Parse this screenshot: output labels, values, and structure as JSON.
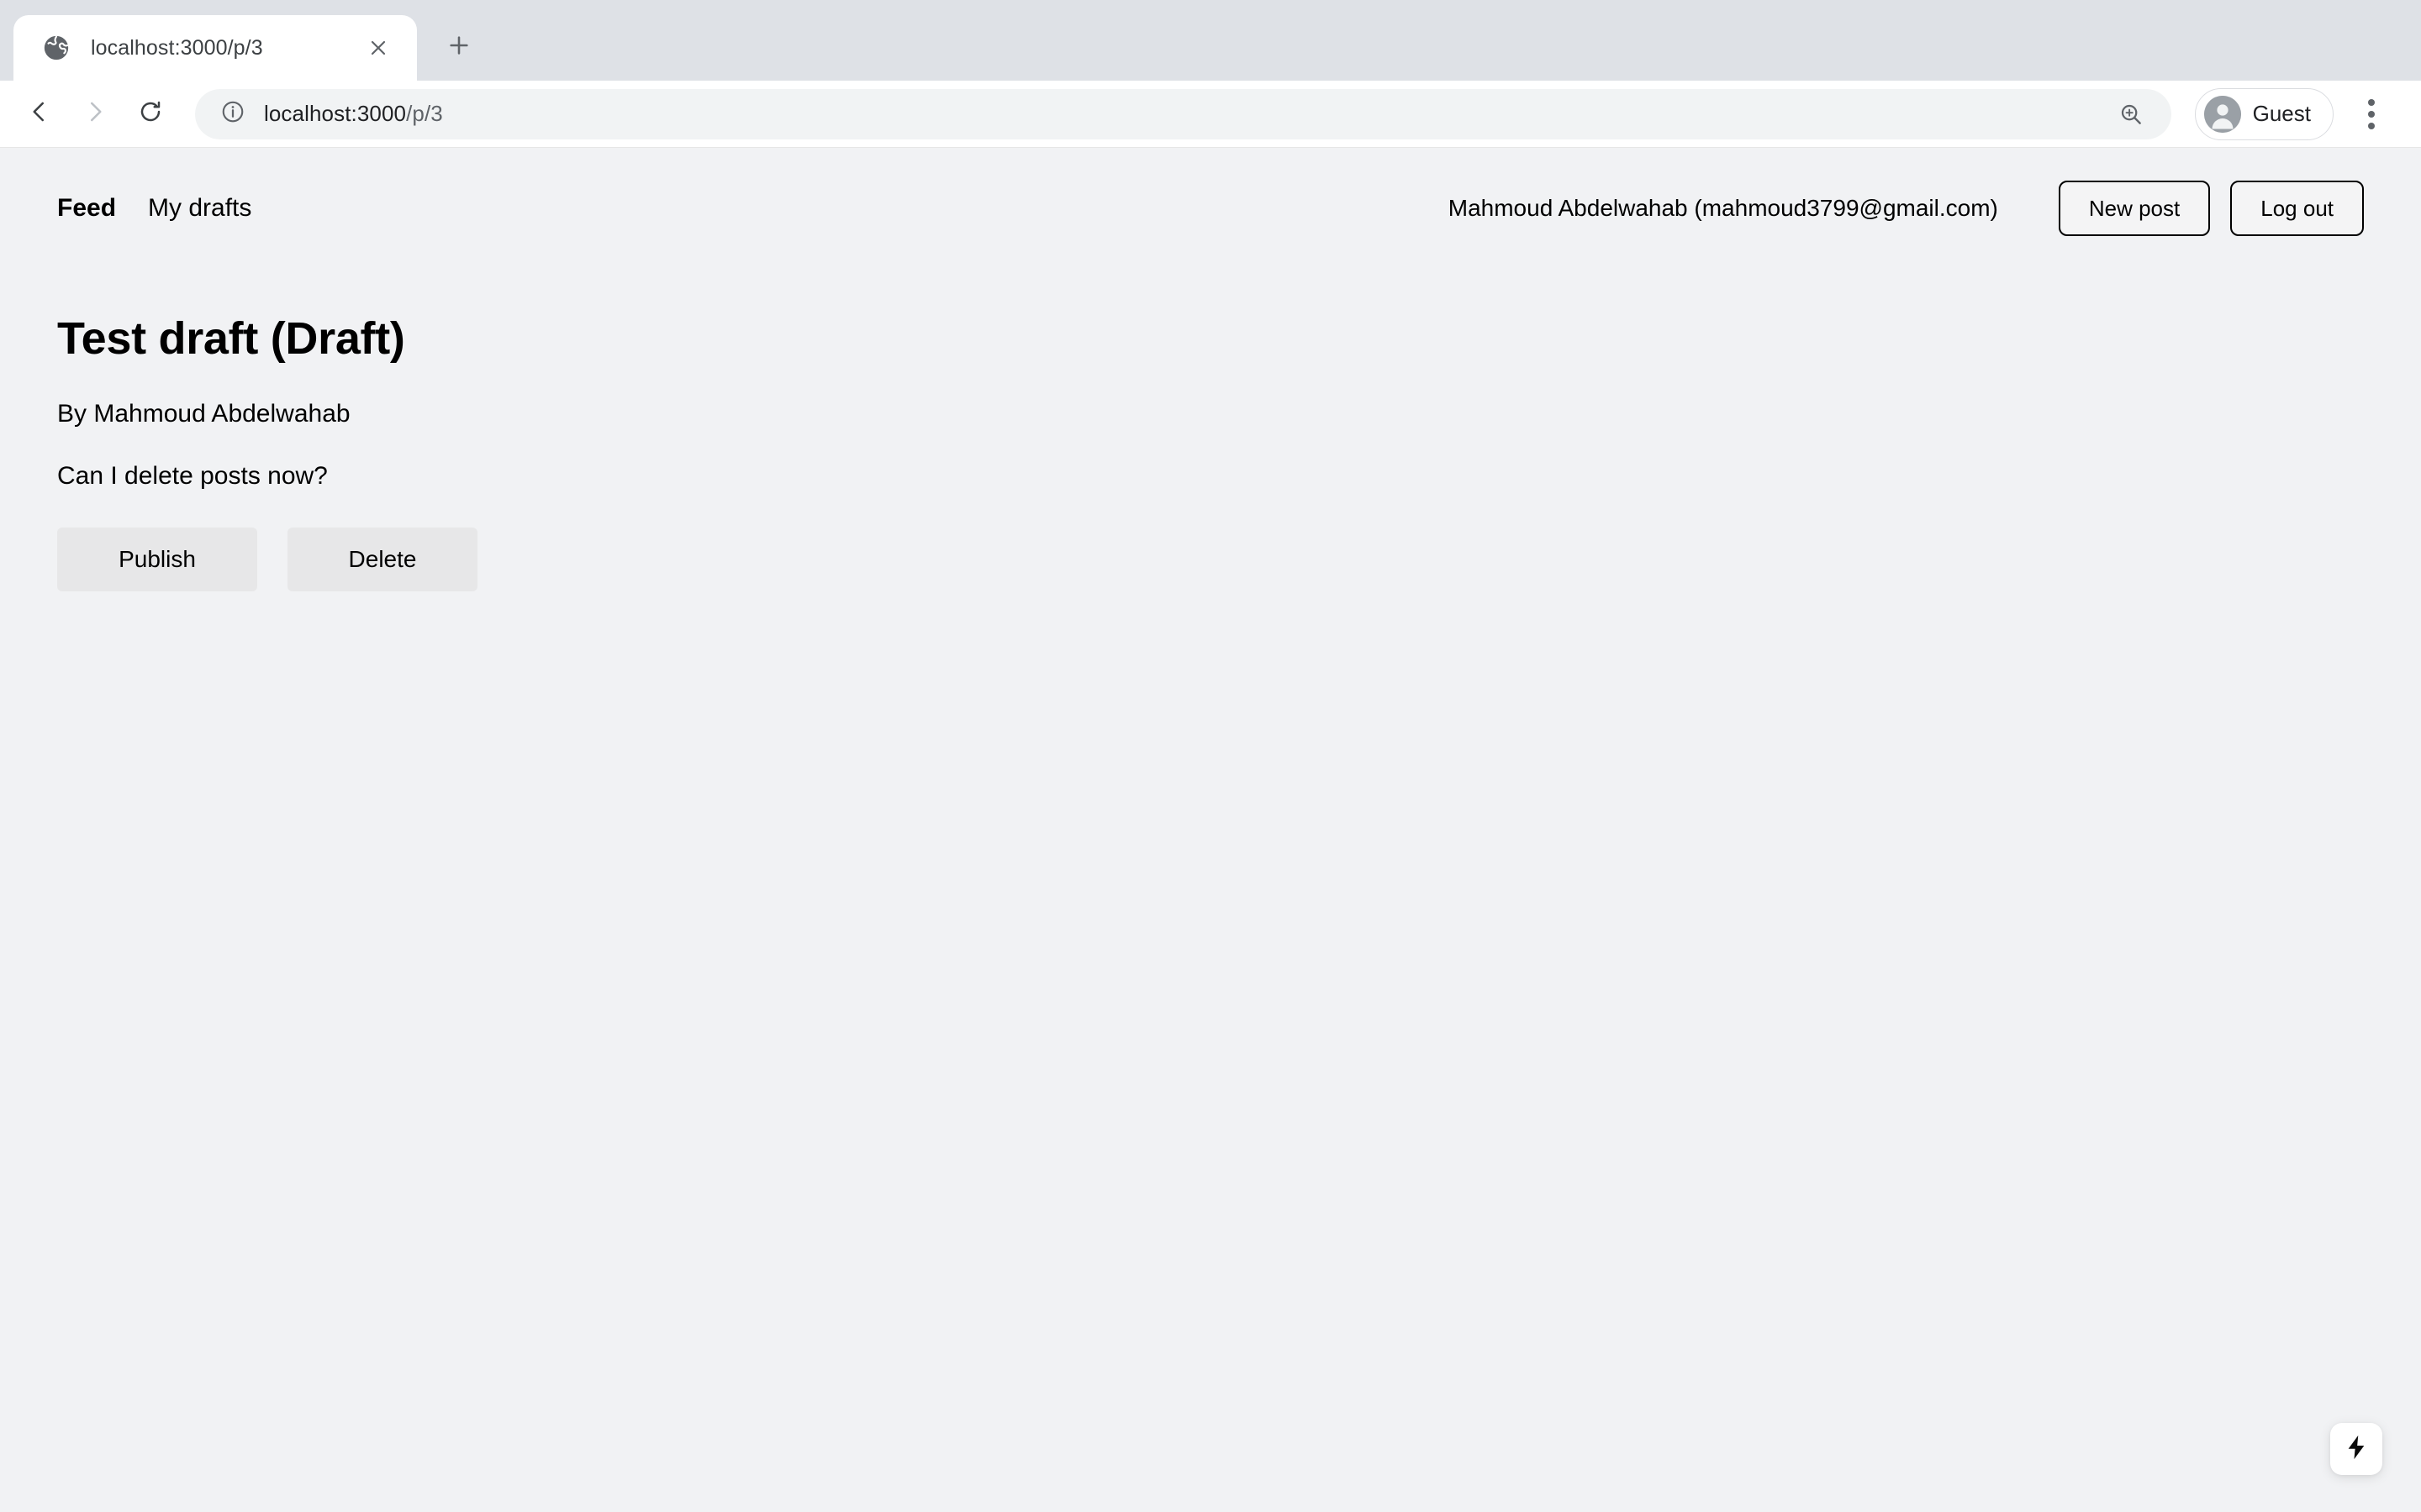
{
  "browser": {
    "tab": {
      "title": "localhost:3000/p/3",
      "favicon_icon": "globe-icon",
      "close_icon": "close-icon"
    },
    "new_tab_icon": "plus-icon",
    "toolbar": {
      "back_icon": "arrow-left-icon",
      "forward_icon": "arrow-right-icon",
      "reload_icon": "reload-icon",
      "site_info_icon": "info-circle-icon",
      "url_host": "localhost:3000",
      "url_path": "/p/3",
      "zoom_icon": "zoom-in-icon",
      "profile_name": "Guest",
      "avatar_icon": "person-icon",
      "menu_icon": "kebab-menu-icon"
    }
  },
  "nav": {
    "links": [
      {
        "label": "Feed",
        "active": true
      },
      {
        "label": "My drafts",
        "active": false
      }
    ],
    "user_label": "Mahmoud Abdelwahab (mahmoud3799@gmail.com)",
    "new_post_label": "New post",
    "log_out_label": "Log out"
  },
  "article": {
    "title": "Test draft (Draft)",
    "author": "By Mahmoud Abdelwahab",
    "body": "Can I delete posts now?",
    "publish_label": "Publish",
    "delete_label": "Delete"
  },
  "dev_tools": {
    "indicator_icon": "lightning-bolt-icon"
  },
  "colors": {
    "page_background": "#f1f2f4",
    "tabstrip_background": "#dee1e6",
    "toolbar_background": "#ffffff",
    "omnibox_background": "#f1f3f4",
    "text_primary": "#000000",
    "button_fill": "#e7e7e8",
    "button_border": "#000000"
  }
}
